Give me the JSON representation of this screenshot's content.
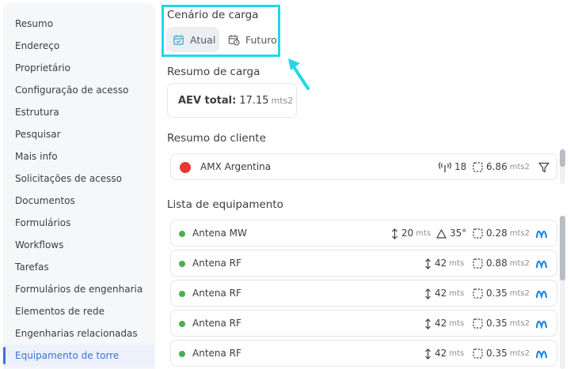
{
  "sidebar": {
    "items": [
      {
        "label": "Resumo"
      },
      {
        "label": "Endereço"
      },
      {
        "label": "Proprietário"
      },
      {
        "label": "Configuração de acesso"
      },
      {
        "label": "Estrutura"
      },
      {
        "label": "Pesquisar"
      },
      {
        "label": "Mais info"
      },
      {
        "label": "Solicitações de acesso"
      },
      {
        "label": "Documentos"
      },
      {
        "label": "Formulários"
      },
      {
        "label": "Workflows"
      },
      {
        "label": "Tarefas"
      },
      {
        "label": "Formulários de engenharia"
      },
      {
        "label": "Elementos de rede"
      },
      {
        "label": "Engenharias relacionadas"
      },
      {
        "label": "Equipamento de torre",
        "active": true
      }
    ]
  },
  "scenario": {
    "title": "Cenário de carga",
    "current_label": "Atual",
    "future_label": "Futuro",
    "selected": "Atual"
  },
  "load_summary": {
    "title": "Resumo de carga",
    "label": "AEV total:",
    "value": "17.15",
    "unit": "mts2"
  },
  "client_summary": {
    "title": "Resumo do cliente",
    "client": {
      "name": "AMX Argentina",
      "antennas": "18",
      "area": "6.86",
      "area_unit": "mts2",
      "icon": "argentina-flag-icon"
    }
  },
  "equipment": {
    "title": "Lista de equipamento",
    "items": [
      {
        "name": "Antena MW",
        "height": "20",
        "height_unit": "mts",
        "angle": "35°",
        "area": "0.28",
        "area_unit": "mts2"
      },
      {
        "name": "Antena RF",
        "height": "42",
        "height_unit": "mts",
        "area": "0.88",
        "area_unit": "mts2"
      },
      {
        "name": "Antena RF",
        "height": "42",
        "height_unit": "mts",
        "area": "0.35",
        "area_unit": "mts2"
      },
      {
        "name": "Antena RF",
        "height": "42",
        "height_unit": "mts",
        "area": "0.35",
        "area_unit": "mts2"
      },
      {
        "name": "Antena RF",
        "height": "42",
        "height_unit": "mts",
        "area": "0.35",
        "area_unit": "mts2"
      }
    ]
  },
  "colors": {
    "accent": "#3f6fd8",
    "highlight": "#22d8e4",
    "status_green": "#4caf50",
    "brand_blue": "#1e88e5"
  }
}
